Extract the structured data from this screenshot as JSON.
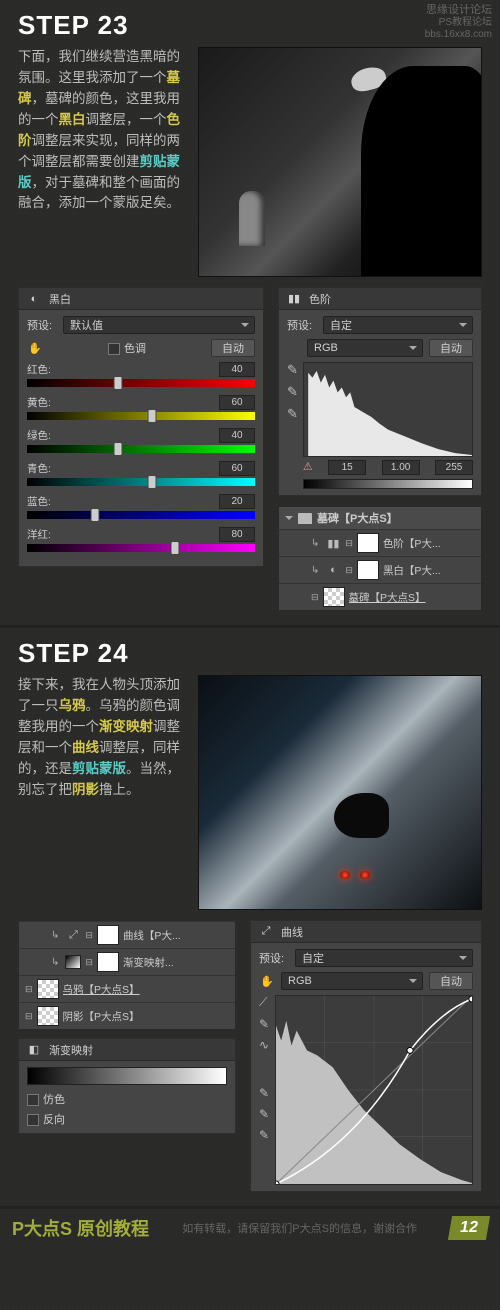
{
  "watermark": {
    "line1": "思缘设计论坛",
    "line2": "bbs.16xx8.com",
    "line3": "PS教程论坛"
  },
  "step23": {
    "title": "STEP 23",
    "body_parts": [
      {
        "t": "下面，我们继续营造黑暗的氛围。这里我添加了一个",
        "c": ""
      },
      {
        "t": "墓碑",
        "c": "hl-yellow"
      },
      {
        "t": "，墓碑的颜色，这里我用的一个",
        "c": ""
      },
      {
        "t": "黑白",
        "c": "hl-yellow"
      },
      {
        "t": "调整层，一个",
        "c": ""
      },
      {
        "t": "色阶",
        "c": "hl-yellow"
      },
      {
        "t": "调整层来实现，同样的两个调整层都需要创建",
        "c": ""
      },
      {
        "t": "剪贴蒙版",
        "c": "hl-cyan"
      },
      {
        "t": "，对于墓碑和整个画面的融合，添加一个蒙版足矣。",
        "c": ""
      }
    ],
    "bw": {
      "title": "黑白",
      "preset_label": "预设:",
      "preset_value": "默认值",
      "tint_label": "色调",
      "auto": "自动",
      "sliders": [
        {
          "name": "红色:",
          "cls": "red",
          "val": "40",
          "pos": 40
        },
        {
          "name": "黄色:",
          "cls": "yellow",
          "val": "60",
          "pos": 55
        },
        {
          "name": "绿色:",
          "cls": "green",
          "val": "40",
          "pos": 40
        },
        {
          "name": "青色:",
          "cls": "cyan",
          "val": "60",
          "pos": 55
        },
        {
          "name": "蓝色:",
          "cls": "blue",
          "val": "20",
          "pos": 30
        },
        {
          "name": "洋红:",
          "cls": "magenta",
          "val": "80",
          "pos": 65
        }
      ]
    },
    "levels": {
      "title": "色阶",
      "preset_label": "预设:",
      "preset_value": "自定",
      "channel": "RGB",
      "auto": "自动",
      "in_black": "15",
      "in_gamma": "1.00",
      "in_white": "255"
    },
    "layers": {
      "group": "墓碑【P大点S】",
      "items": [
        {
          "name": "色阶【P大...",
          "thumb": "white",
          "clip": true,
          "icon": "levels"
        },
        {
          "name": "黑白【P大...",
          "thumb": "white",
          "clip": true,
          "icon": "bw"
        },
        {
          "name": "墓碑【P大点S】",
          "thumb": "checker",
          "clip": false,
          "underline": true
        }
      ]
    }
  },
  "step24": {
    "title": "STEP 24",
    "body_parts": [
      {
        "t": "接下来，我在人物头顶添加了一只",
        "c": ""
      },
      {
        "t": "乌鸦",
        "c": "hl-yellow"
      },
      {
        "t": "。乌鸦的颜色调整我用的一个",
        "c": ""
      },
      {
        "t": "渐变映射",
        "c": "hl-yellow"
      },
      {
        "t": "调整层和一个",
        "c": ""
      },
      {
        "t": "曲线",
        "c": "hl-yellow"
      },
      {
        "t": "调整层，同样的，还是",
        "c": ""
      },
      {
        "t": "剪贴蒙版",
        "c": "hl-cyan"
      },
      {
        "t": "。当然，别忘了把",
        "c": ""
      },
      {
        "t": "阴影",
        "c": "hl-yellow"
      },
      {
        "t": "撸上。",
        "c": ""
      }
    ],
    "curves": {
      "title": "曲线",
      "preset_label": "预设:",
      "preset_value": "自定",
      "channel": "RGB",
      "auto": "自动"
    },
    "layers": {
      "items": [
        {
          "name": "曲线【P大...",
          "thumb": "white",
          "clip": true,
          "icon": "curves"
        },
        {
          "name": "渐变映射...",
          "thumb": "white",
          "clip": true,
          "icon": "grad"
        },
        {
          "name": "乌鸦【P大点S】",
          "thumb": "checker",
          "clip": false,
          "underline": true
        },
        {
          "name": "阴影【P大点S】",
          "thumb": "checker",
          "clip": false
        }
      ]
    },
    "gm": {
      "title": "渐变映射",
      "dither": "仿色",
      "reverse": "反向"
    }
  },
  "footer": {
    "brand": "P大点S 原创教程",
    "note": "如有转载，请保留我们P大点S的信息，谢谢合作",
    "page": "12"
  }
}
